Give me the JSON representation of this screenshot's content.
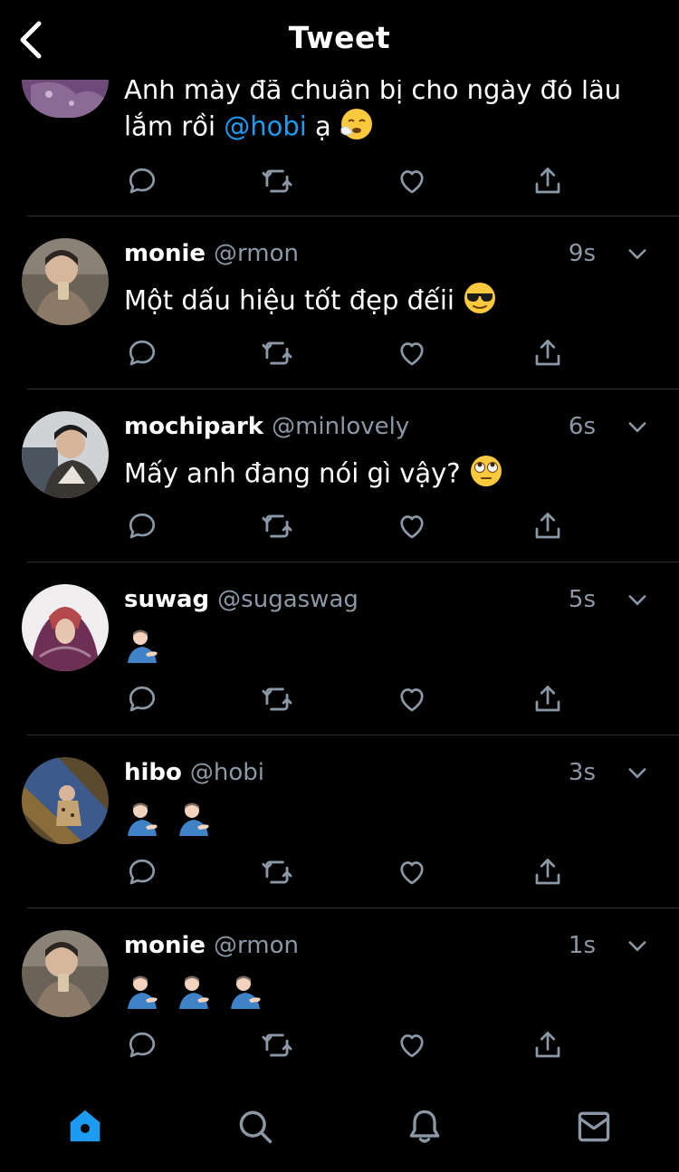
{
  "header": {
    "title": "Tweet"
  },
  "colors": {
    "background": "#000000",
    "text": "#ffffff",
    "muted": "#8b98a5",
    "accent": "#1d9bf0",
    "divider": "#2f3336"
  },
  "top_tweet": {
    "text_before": "Anh mày đã chuân bị cho ngày đó lâu lắm rồi ",
    "mention": "@hobi",
    "text_after": " ạ",
    "emoji": "sneezing-face"
  },
  "tweets": [
    {
      "name": "monie",
      "handle": "@rmon",
      "time": "9s",
      "text": "Một dấu hiệu tốt đẹp đếii",
      "emoji": "sunglasses-face"
    },
    {
      "name": "mochipark",
      "handle": "@minlovely",
      "time": "6s",
      "text": "Mấy anh đang nói gì vậy?",
      "emoji": "eye-roll-face"
    },
    {
      "name": "suwag",
      "handle": "@sugaswag",
      "time": "5s",
      "text": "",
      "emoji_count": 1
    },
    {
      "name": "hibo",
      "handle": "@hobi",
      "time": "3s",
      "text": "",
      "emoji_count": 2
    },
    {
      "name": "monie",
      "handle": "@rmon",
      "time": "1s",
      "text": "",
      "emoji_count": 3
    }
  ],
  "icons": {
    "back": "chevron-left-icon",
    "reply": "reply-icon",
    "retweet": "retweet-icon",
    "like": "heart-icon",
    "share": "share-icon",
    "more": "chevron-down-icon",
    "nav": [
      "home-icon",
      "search-icon",
      "notifications-icon",
      "messages-icon"
    ]
  },
  "nav": {
    "active": "home"
  }
}
